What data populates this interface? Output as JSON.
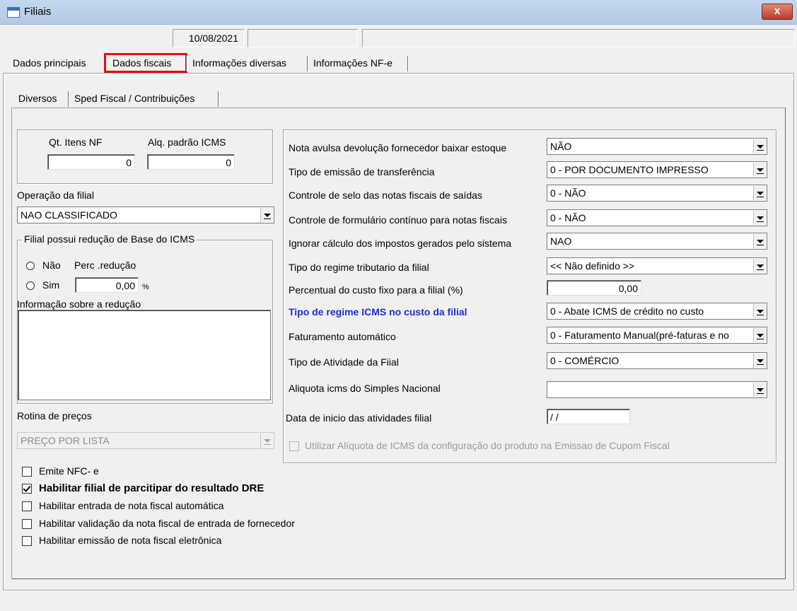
{
  "window": {
    "title": "Filiais",
    "close_label": "x"
  },
  "status": {
    "date": "10/08/2021",
    "box2": "",
    "box3": ""
  },
  "tabs": [
    "Dados principais",
    "Dados fiscais",
    "Informações diversas",
    "Informações NF-e"
  ],
  "subtabs": [
    "Diversos",
    "Sped Fiscal / Contribuições"
  ],
  "left": {
    "qt_itens_label": "Qt. Itens NF",
    "qt_itens_value": "0",
    "alq_icms_label": "Alq. padrão ICMS",
    "alq_icms_value": "0",
    "operacao_label": "Operação da filial",
    "operacao_value": "NAO CLASSIFICADO",
    "reducao_group_label": "Filial possui redução de Base do ICMS",
    "radio_nao": "Não",
    "radio_sim": "Sim",
    "perc_label": "Perc .redução",
    "perc_value": "0,00",
    "perc_unit": "%",
    "info_label": "Informação sobre a redução",
    "info_value": "",
    "rotina_label": "Rotina de preços",
    "rotina_value": "PREÇO POR LISTA"
  },
  "right": {
    "rows": [
      {
        "label": "Nota avulsa devolução fornecedor baixar estoque",
        "value": "NÃO"
      },
      {
        "label": "Tipo de emissão de transferência",
        "value": "0 - POR DOCUMENTO IMPRESSO"
      },
      {
        "label": "Controle de selo das notas fiscais de saídas",
        "value": "0 - NÃO"
      },
      {
        "label": "Controle de formulário contínuo para notas fiscais",
        "value": "0 - NÃO"
      },
      {
        "label": "Ignorar cálculo dos impostos gerados pelo sistema",
        "value": "NAO"
      },
      {
        "label": "Tipo do regime tributario da filial",
        "value": "<< Não definido >>"
      },
      {
        "label": "Percentual do custo fixo para a filial (%)",
        "value": "0,00"
      },
      {
        "label": "Tipo de regime ICMS no custo da filial",
        "value": "0 - Abate ICMS de crédito no custo"
      },
      {
        "label": "Faturamento automático",
        "value": "0 - Faturamento Manual(pré-faturas e no"
      },
      {
        "label": "Tipo de Atividade da Fiial",
        "value": "0 - COMÉRCIO"
      },
      {
        "label": "Aliquota icms do Simples Nacional",
        "value": ""
      },
      {
        "label": "Data de inicio das atividades filial",
        "value": " / /"
      }
    ],
    "utilizar_label": "Utilizar Alíquota de ICMS da configuração do produto na Emissao de Cupom Fiscal"
  },
  "checks": [
    {
      "label": "Emite NFC- e",
      "checked": false
    },
    {
      "label": "Habilitar filial de parcitipar do resultado DRE",
      "checked": true
    },
    {
      "label": "Habilitar entrada de nota fiscal automática",
      "checked": false
    },
    {
      "label": "Habilitar validação da nota fiscal de entrada de fornecedor",
      "checked": false
    },
    {
      "label": "Habilitar emissão de nota fiscal eletrônica",
      "checked": false
    }
  ],
  "colors": {
    "highlight_border": "#e01010",
    "blue_label": "#1a2ed8",
    "titlebar": "#b9cfea"
  }
}
